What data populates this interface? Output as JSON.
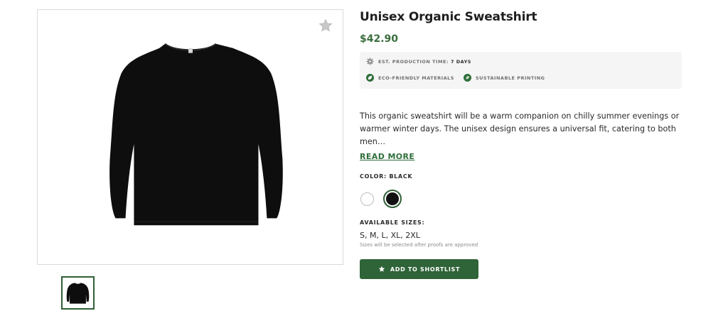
{
  "product": {
    "title": "Unisex Organic Sweatshirt",
    "price": "$42.90"
  },
  "info": {
    "production_label": "EST. PRODUCTION TIME:",
    "production_value": "7 DAYS",
    "features": [
      "ECO-FRIENDLY MATERIALS",
      "SUSTAINABLE PRINTING"
    ]
  },
  "description": {
    "text": "This organic sweatshirt will be a warm companion on chilly summer evenings or warmer winter days. The unisex design ensures a universal fit, catering to both men…",
    "read_more": "READ MORE"
  },
  "color": {
    "label": "COLOR: BLACK",
    "options": [
      "white",
      "black"
    ],
    "selected": "black",
    "swatch_colors": {
      "white": "#ffffff",
      "black": "#111111"
    }
  },
  "sizes": {
    "label": "AVAILABLE SIZES:",
    "value": "S, M, L, XL, 2XL",
    "note": "Sizes will be selected after proofs are approved"
  },
  "actions": {
    "shortlist_label": "ADD TO SHORTLIST"
  },
  "theme": {
    "accent": "#2f6338",
    "price_color": "#3b6e3e"
  },
  "icons": {
    "favorite": "star-icon",
    "production": "gear-icon",
    "eco": "eco-leaf-icon",
    "printing": "leaf-icon",
    "button": "star-icon"
  }
}
